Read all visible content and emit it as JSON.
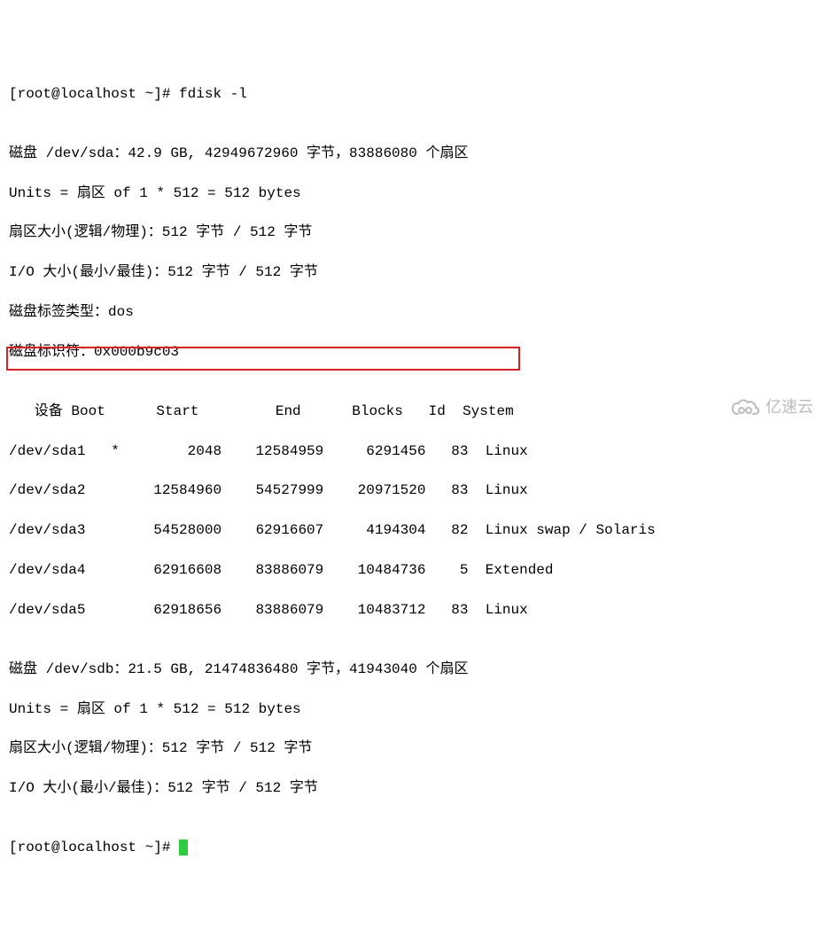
{
  "prompt1": "[root@localhost ~]# fdisk -l",
  "blank1": "",
  "disk_sda_header": "磁盘 /dev/sda：42.9 GB, 42949672960 字节，83886080 个扇区",
  "units_sda": "Units = 扇区 of 1 * 512 = 512 bytes",
  "sector_size_sda": "扇区大小(逻辑/物理)：512 字节 / 512 字节",
  "io_size_sda": "I/O 大小(最小/最佳)：512 字节 / 512 字节",
  "label_type": "磁盘标签类型：dos",
  "disk_identifier": "磁盘标识符：0x000b9c03",
  "blank2": "",
  "table_header": "   设备 Boot      Start         End      Blocks   Id  System",
  "row_sda1": "/dev/sda1   *        2048    12584959     6291456   83  Linux",
  "row_sda2": "/dev/sda2        12584960    54527999    20971520   83  Linux",
  "row_sda3": "/dev/sda3        54528000    62916607     4194304   82  Linux swap / Solaris",
  "row_sda4": "/dev/sda4        62916608    83886079    10484736    5  Extended",
  "row_sda5": "/dev/sda5        62918656    83886079    10483712   83  Linux",
  "blank3": "",
  "disk_sdb_header": "磁盘 /dev/sdb：21.5 GB, 21474836480 字节，41943040 个扇区",
  "units_sdb": "Units = 扇区 of 1 * 512 = 512 bytes",
  "sector_size_sdb": "扇区大小(逻辑/物理)：512 字节 / 512 字节",
  "io_size_sdb": "I/O 大小(最小/最佳)：512 字节 / 512 字节",
  "blank4": "",
  "prompt2": "[root@localhost ~]# ",
  "watermark_text": "亿速云",
  "chart_data": {
    "type": "table",
    "title": "fdisk -l output partition table",
    "columns": [
      "设备",
      "Boot",
      "Start",
      "End",
      "Blocks",
      "Id",
      "System"
    ],
    "rows": [
      {
        "device": "/dev/sda1",
        "boot": "*",
        "start": 2048,
        "end": 12584959,
        "blocks": 6291456,
        "id": "83",
        "system": "Linux"
      },
      {
        "device": "/dev/sda2",
        "boot": "",
        "start": 12584960,
        "end": 54527999,
        "blocks": 20971520,
        "id": "83",
        "system": "Linux"
      },
      {
        "device": "/dev/sda3",
        "boot": "",
        "start": 54528000,
        "end": 62916607,
        "blocks": 4194304,
        "id": "82",
        "system": "Linux swap / Solaris"
      },
      {
        "device": "/dev/sda4",
        "boot": "",
        "start": 62916608,
        "end": 83886079,
        "blocks": 10484736,
        "id": "5",
        "system": "Extended"
      },
      {
        "device": "/dev/sda5",
        "boot": "",
        "start": 62918656,
        "end": 83886079,
        "blocks": 10483712,
        "id": "83",
        "system": "Linux"
      }
    ],
    "disks": [
      {
        "name": "/dev/sda",
        "size_gb": 42.9,
        "bytes": 42949672960,
        "sectors": 83886080,
        "label_type": "dos",
        "identifier": "0x000b9c03"
      },
      {
        "name": "/dev/sdb",
        "size_gb": 21.5,
        "bytes": 21474836480,
        "sectors": 41943040
      }
    ],
    "sector_size": {
      "logical": 512,
      "physical": 512
    },
    "io_size": {
      "min": 512,
      "optimal": 512
    },
    "units": "扇区 of 1 * 512 = 512 bytes"
  }
}
